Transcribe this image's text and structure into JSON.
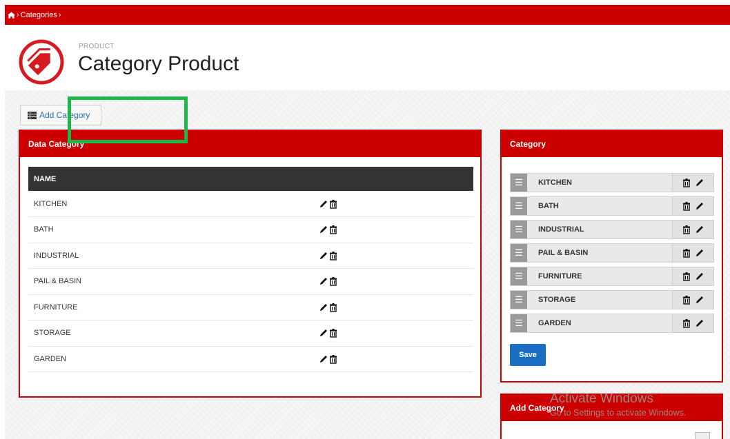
{
  "breadcrumb": {
    "items": [
      "Categories"
    ]
  },
  "header": {
    "subtitle": "PRODUCT",
    "title": "Category Product"
  },
  "toolbar": {
    "add_category_label": "Add Category"
  },
  "data_panel": {
    "title": "Data Category",
    "column_header": "NAME",
    "rows": [
      "KITCHEN",
      "BATH",
      "INDUSTRIAL",
      "PAIL & BASIN",
      "FURNITURE",
      "STORAGE",
      "GARDEN"
    ]
  },
  "category_panel": {
    "title": "Category",
    "items": [
      "KITCHEN",
      "BATH",
      "INDUSTRIAL",
      "PAIL & BASIN",
      "FURNITURE",
      "STORAGE",
      "GARDEN"
    ],
    "save_label": "Save"
  },
  "add_panel": {
    "title": "Add Category"
  },
  "watermark": {
    "line1": "Activate Windows",
    "line2": "Go to Settings to activate Windows."
  },
  "colors": {
    "brand": "#cc0000",
    "primary": "#1a6fc4",
    "highlight": "#1db74a"
  }
}
